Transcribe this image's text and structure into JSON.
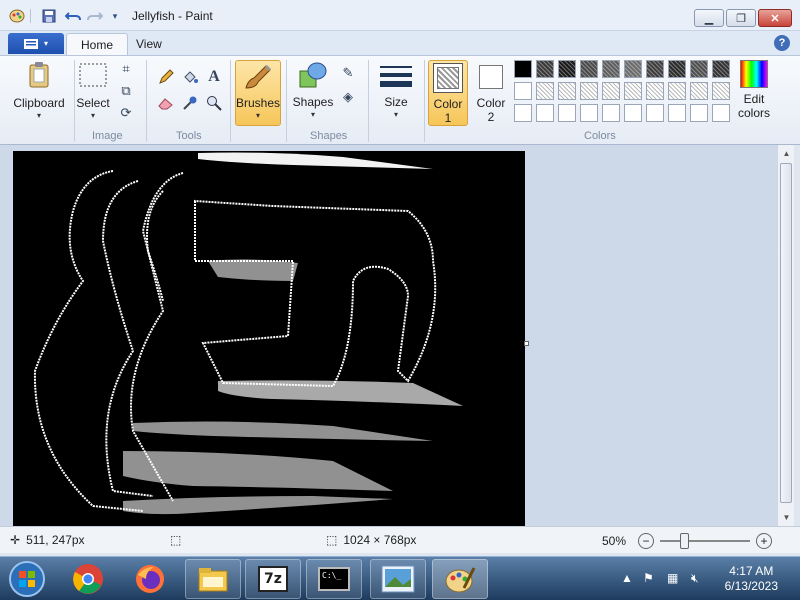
{
  "window": {
    "title": "Jellyfish - Paint",
    "minimize_icon": "minimize-icon",
    "maximize_icon": "maximize-icon",
    "close_icon": "close-icon"
  },
  "quick_access": [
    "paint-app-icon",
    "save-icon",
    "undo-icon",
    "redo-icon",
    "customize-dropdown-icon"
  ],
  "tabs": {
    "file_icon": "file-menu-icon",
    "home": "Home",
    "view": "View",
    "help_icon": "help-icon"
  },
  "ribbon": {
    "clipboard": {
      "label": "Clipboard"
    },
    "image": {
      "select": "Select",
      "group": "Image"
    },
    "tools": {
      "group": "Tools"
    },
    "brushes": {
      "label": "Brushes"
    },
    "shapes": {
      "label": "Shapes",
      "group": "Shapes"
    },
    "size": {
      "label": "Size"
    },
    "color1": {
      "label": "Color",
      "num": "1"
    },
    "color2": {
      "label": "Color",
      "num": "2"
    },
    "edit_colors": {
      "line1": "Edit",
      "line2": "colors"
    },
    "colors_group": "Colors",
    "palette_row1": [
      "#000000",
      "#3a3a3a",
      "#1a1a1a",
      "#4a4a4a",
      "#5e5e5e",
      "#6c6c6c",
      "#3e3e3e",
      "#2c2c2c",
      "#4f4f4f",
      "#333333"
    ]
  },
  "status": {
    "position": "511, 247px",
    "canvas_size": "1024 × 768px",
    "zoom": "50%",
    "zoom_level": 0.5
  },
  "taskbar": {
    "time": "4:17 AM",
    "date": "6/13/2023"
  }
}
